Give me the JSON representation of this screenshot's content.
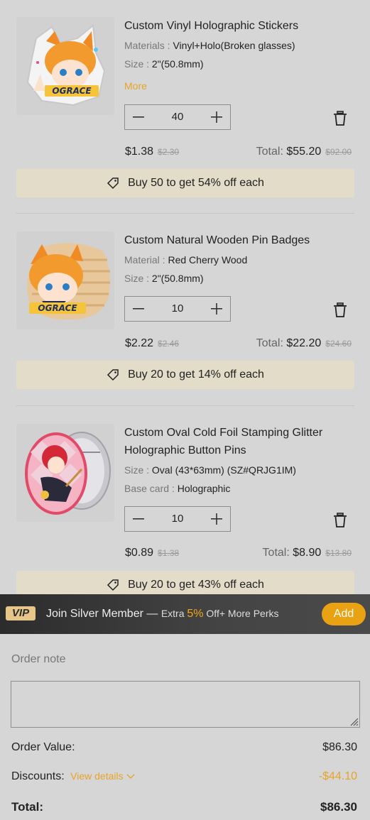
{
  "items": [
    {
      "title": "Custom Vinyl Holographic Stickers",
      "attr1_key": "Materials : ",
      "attr1_val": "Vinyl+Holo(Broken glasses)",
      "attr2_key": "Size : ",
      "attr2_val": "2\"(50.8mm)",
      "more_label": "More",
      "qty": "40",
      "price": "$1.38",
      "old_price": "$2.30",
      "total_label": "Total:",
      "total": "$55.20",
      "old_total": "$92.00",
      "promo": "Buy 50 to get 54% off each",
      "thumb_label": "OGRACE"
    },
    {
      "title": "Custom Natural Wooden Pin Badges",
      "attr1_key": "Material : ",
      "attr1_val": "Red Cherry Wood",
      "attr2_key": "Size : ",
      "attr2_val": "2\"(50.8mm)",
      "qty": "10",
      "price": "$2.22",
      "old_price": "$2.46",
      "total_label": "Total:",
      "total": "$22.20",
      "old_total": "$24.60",
      "promo": "Buy 20 to get 14% off each",
      "thumb_label": "OGRACE"
    },
    {
      "title": "Custom Oval Cold Foil Stamping Glitter Holographic Button Pins",
      "attr1_key": "Size : ",
      "attr1_val": "Oval (43*63mm) (SZ#QRJG1IM)",
      "attr2_key": "Base card : ",
      "attr2_val": "Holographic",
      "qty": "10",
      "price": "$0.89",
      "old_price": "$1.38",
      "total_label": "Total:",
      "total": "$8.90",
      "old_total": "$13.80",
      "promo": "Buy 20 to get 43% off each"
    }
  ],
  "vip": {
    "badge": "VIP",
    "join": "Join Silver Member",
    "dash": " — ",
    "extra": "Extra ",
    "pct": "5%",
    "perks": " Off+ More Perks",
    "add": "Add"
  },
  "order": {
    "note_label": "Order note",
    "value_label": "Order Value",
    "value": "$86.30",
    "discounts_label": "Discounts",
    "view_details": "View details",
    "discount": "-$44.10",
    "total_label": "Total",
    "total": "$86.30"
  },
  "colors": {
    "accent": "#e5a42a",
    "promo_bg": "#e2dcc8",
    "vip_bar": "#3a3a3a"
  }
}
